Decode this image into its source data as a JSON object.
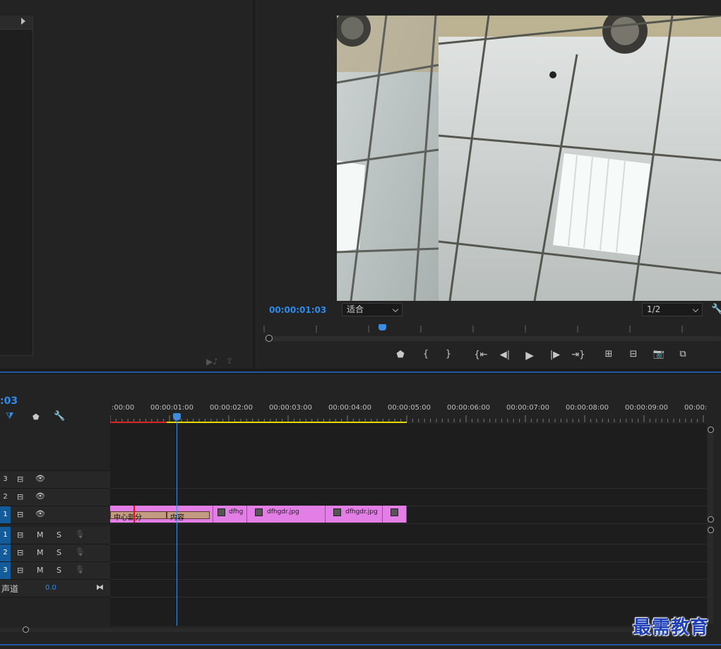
{
  "program_monitor": {
    "timecode": "00:00:01:03",
    "fit_label": "适合",
    "quality_label": "1/2",
    "playhead_fraction": 0.26
  },
  "timeline": {
    "timecode": ":03",
    "ruler_labels": [
      ":00:00",
      "00:00:01:00",
      "00:00:02:00",
      "00:00:03:00",
      "00:00:04:00",
      "00:00:05:00",
      "00:00:06:00",
      "00:00:07:00",
      "00:00:08:00",
      "00:00:09:00",
      "00:00:"
    ],
    "video_tracks": [
      {
        "num": "3",
        "active": false
      },
      {
        "num": "2",
        "active": false
      },
      {
        "num": "1",
        "active": true
      }
    ],
    "audio_tracks": [
      {
        "num": "1",
        "m": "M",
        "s": "S"
      },
      {
        "num": "2",
        "m": "M",
        "s": "S"
      },
      {
        "num": "3",
        "m": "M",
        "s": "S"
      }
    ],
    "master_label": "声道",
    "master_value": "0.0",
    "clips": [
      {
        "label": "dfhg"
      },
      {
        "label": "dfhgdr.jpg"
      },
      {
        "label": "dfhgdr.jpg"
      },
      {
        "label": ""
      }
    ],
    "titles": [
      {
        "label": "中心部分"
      },
      {
        "label": "内容"
      }
    ]
  },
  "watermark": "最需教育",
  "icons": {
    "marker": "marker-icon",
    "wrench": "wrench-icon",
    "snap": "snap-icon"
  },
  "colors": {
    "accent": "#2d8ceb",
    "clip": "#e27ee6",
    "work_area": "#e5d500"
  }
}
